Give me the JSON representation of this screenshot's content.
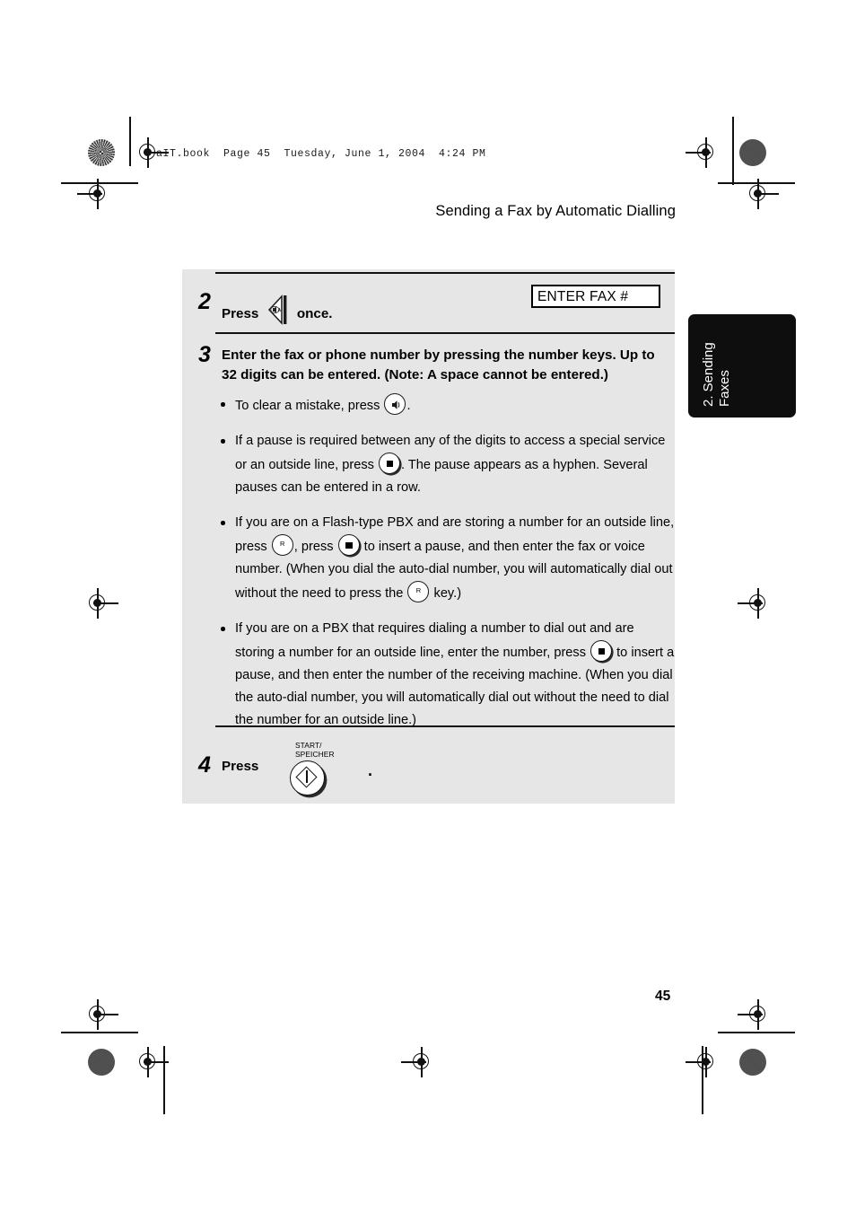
{
  "page": {
    "imposition_line": "aIT.book  Page 45  Tuesday, June 1, 2004  4:24 PM",
    "running_head": "Sending a Fax by Automatic Dialling",
    "folio": "45",
    "panel_bg_color": "#e6e6e6",
    "tab_bg_color": "#0e0e0e"
  },
  "thumb_tab": {
    "label": "2. Sending\nFaxes"
  },
  "steps": [
    {
      "number": "2",
      "text_before": "Press",
      "key_icon": "speaker-key-icon",
      "text_after": "once.",
      "lcd": "ENTER FAX #"
    },
    {
      "number": "3",
      "text": "Enter the fax or phone number by pressing the number keys. Up to 32 digits can be entered. (Note: A space cannot be entered.)"
    },
    {
      "number": "4",
      "text_before": "Press",
      "key_label": "START/\nSPEICHER",
      "key_icon": "start-key-icon",
      "text_after": "."
    }
  ],
  "bullets": [
    {
      "id": "clear-mistake",
      "seg1": "To clear a mistake, press ",
      "icon1": "speaker-clear-key-icon",
      "seg2": "."
    },
    {
      "id": "pause-digits",
      "seg1": "If a pause is required between any of the digits to access a special service or an outside line, press ",
      "icon1": "pause-key-icon",
      "seg2": ". The pause appears as a hyphen. Several pauses can be entered in a row."
    },
    {
      "id": "flash-pbx",
      "seg1": "If you are on a Flash-type PBX and are storing a number for an outside line, press ",
      "icon1": "r-key-icon",
      "seg2": ", press ",
      "icon2": "pause-key-icon",
      "seg3": " to insert a pause, and then enter the fax or voice number. (When you dial the auto-dial number, you will automatically dial out without the need to press the ",
      "icon3": "r-key-icon",
      "seg4": " key.)"
    },
    {
      "id": "dialout-pbx",
      "seg1": "If you are on a PBX that requires dialing a number to dial out and are storing a number for an outside line, enter the number, press ",
      "icon1": "pause-key-icon",
      "seg2": " to insert a pause, and then enter the number of the receiving machine. (When you dial the auto-dial number, you will automatically dial out without the need to dial the number for an outside line.)"
    }
  ]
}
